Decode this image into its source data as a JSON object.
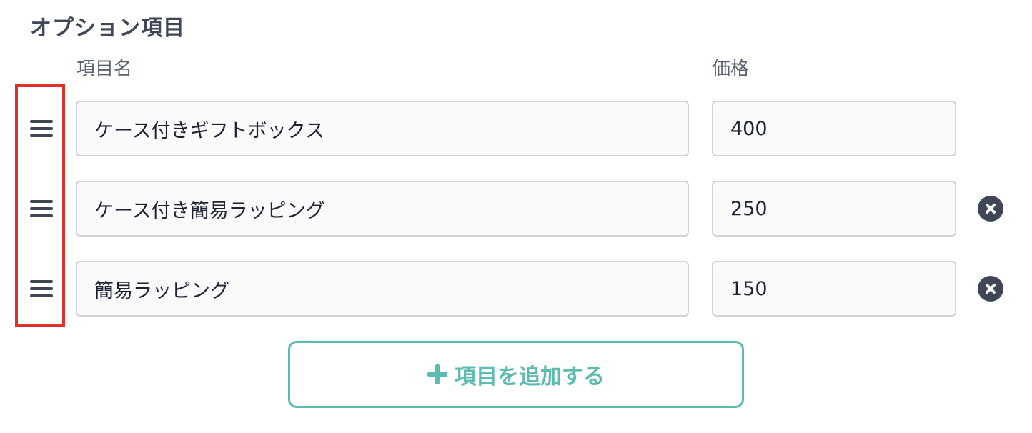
{
  "section": {
    "title": "オプション項目"
  },
  "columns": {
    "name": "項目名",
    "price": "価格"
  },
  "options": [
    {
      "name": "ケース付きギフトボックス",
      "price": "400",
      "removable": false
    },
    {
      "name": "ケース付き簡易ラッピング",
      "price": "250",
      "removable": true
    },
    {
      "name": "簡易ラッピング",
      "price": "150",
      "removable": true
    }
  ],
  "add_button": {
    "label": "項目を追加する",
    "icon": "plus-icon"
  },
  "icons": {
    "drag": "drag-handle-icon",
    "remove": "close-circle-icon"
  },
  "colors": {
    "accent": "#5cbcb0",
    "text": "#3f4756",
    "highlight": "#e0302a",
    "field_border": "#cfd3d9"
  }
}
